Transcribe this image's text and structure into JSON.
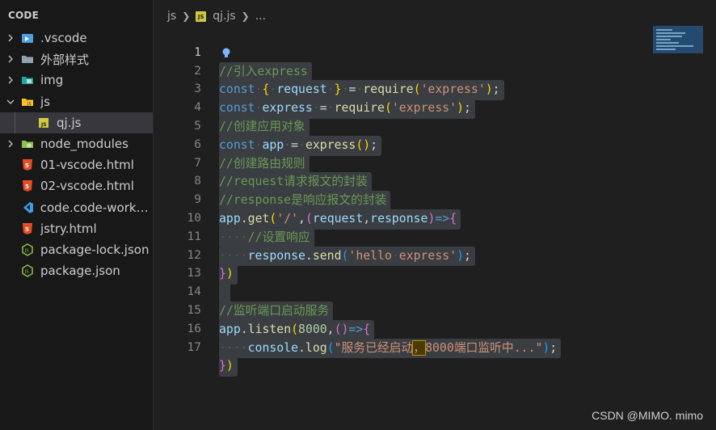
{
  "explorer": {
    "title": "CODE",
    "items": [
      {
        "label": ".vscode",
        "icon": "vscode-folder-icon",
        "kind": "folder",
        "expanded": false
      },
      {
        "label": "外部样式",
        "icon": "folder-icon",
        "kind": "folder",
        "expanded": false
      },
      {
        "label": "img",
        "icon": "image-folder-icon",
        "kind": "folder",
        "expanded": false
      },
      {
        "label": "js",
        "icon": "js-folder-icon",
        "kind": "folder",
        "expanded": true
      },
      {
        "label": "qj.js",
        "icon": "js-file-icon",
        "kind": "file",
        "selected": true,
        "nested": true
      },
      {
        "label": "node_modules",
        "icon": "node-folder-icon",
        "kind": "folder",
        "expanded": false
      },
      {
        "label": "01-vscode.html",
        "icon": "html-file-icon",
        "kind": "file"
      },
      {
        "label": "02-vscode.html",
        "icon": "html-file-icon",
        "kind": "file"
      },
      {
        "label": "code.code-works...",
        "icon": "vscode-file-icon",
        "kind": "file"
      },
      {
        "label": "jstry.html",
        "icon": "html-file-icon",
        "kind": "file"
      },
      {
        "label": "package-lock.json",
        "icon": "json-file-icon",
        "kind": "file"
      },
      {
        "label": "package.json",
        "icon": "json-file-icon",
        "kind": "file"
      }
    ]
  },
  "breadcrumb": {
    "folder": "js",
    "file": "qj.js",
    "symbol": "...",
    "file_badge": "JS"
  },
  "editor": {
    "line_numbers": [
      "1",
      "2",
      "3",
      "4",
      "5",
      "6",
      "7",
      "8",
      "9",
      "10",
      "11",
      "12",
      "13",
      "14",
      "15",
      "16",
      "17"
    ],
    "active_line": "1"
  },
  "watermark": "CSDN @MIMO. mimo",
  "colors": {
    "background": "#1f1f1f",
    "sidebar": "#181818",
    "comment": "#6a9955",
    "keyword": "#569cd6",
    "variable": "#9cdcfe",
    "function": "#dcdcaa",
    "string": "#ce9178",
    "number": "#b5cea8"
  }
}
